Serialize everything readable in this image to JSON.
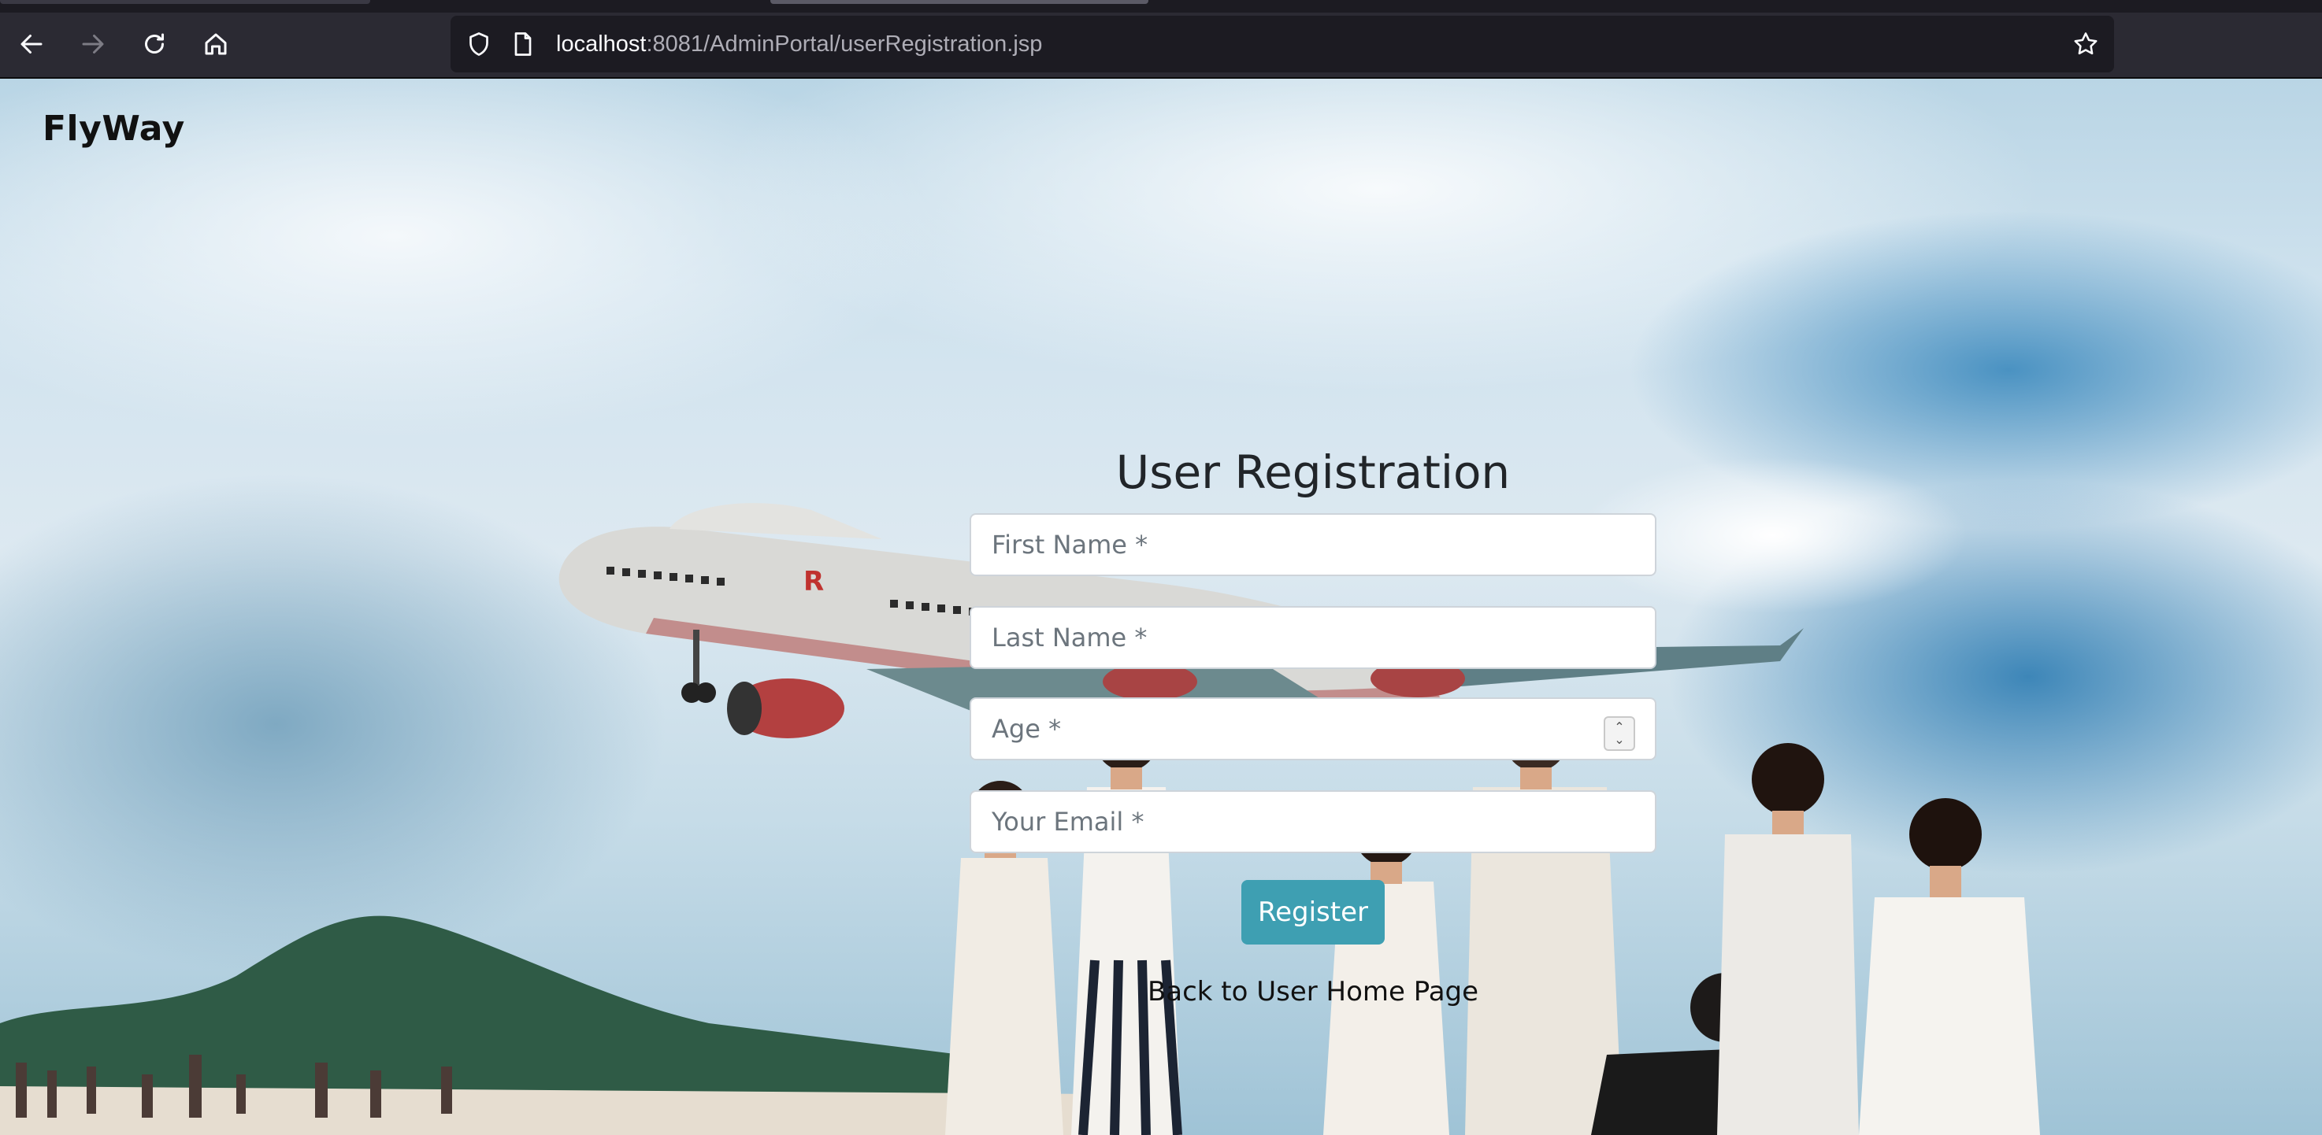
{
  "browser": {
    "url_host": "localhost",
    "url_rest": ":8081/AdminPortal/userRegistration.jsp",
    "icons": [
      "back-arrow-icon",
      "forward-arrow-icon",
      "reload-icon",
      "home-icon",
      "shield-icon",
      "page-icon",
      "star-icon"
    ]
  },
  "site": {
    "brand": "FlyWay"
  },
  "form": {
    "title": "User Registration",
    "first_name_placeholder": "First Name *",
    "last_name_placeholder": "Last Name *",
    "age_placeholder": "Age *",
    "email_placeholder": "Your Email *",
    "register_label": "Register",
    "back_link": "Back to User Home Page"
  },
  "colors": {
    "accent": "#3e9fb2",
    "chrome_bg": "#2b2a33",
    "url_bg": "#1c1b22"
  }
}
